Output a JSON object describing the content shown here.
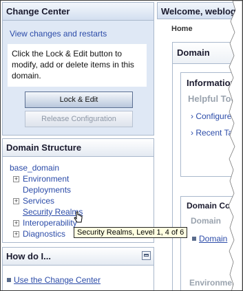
{
  "change_center": {
    "title": "Change Center",
    "view_changes_link": "View changes and restarts",
    "message": "Click the Lock & Edit button to modify, add or delete items in this domain.",
    "lock_edit_label": "Lock & Edit",
    "release_config_label": "Release Configuration"
  },
  "domain_structure": {
    "title": "Domain Structure",
    "root": "base_domain",
    "items": [
      {
        "label": "Environment",
        "expandable": true
      },
      {
        "label": "Deployments",
        "expandable": false
      },
      {
        "label": "Services",
        "expandable": true
      },
      {
        "label": "Security Realms",
        "expandable": false
      },
      {
        "label": "Interoperability",
        "expandable": true
      },
      {
        "label": "Diagnostics",
        "expandable": true
      }
    ],
    "tooltip": "Security Realms, Level 1, 4 of 6"
  },
  "how_do_i": {
    "title": "How do I...",
    "link": "Use the Change Center"
  },
  "header": {
    "welcome": "Welcome, weblogic"
  },
  "breadcrumb": {
    "home": "Home"
  },
  "domain_panel": {
    "title": "Domain",
    "information": {
      "title": "Information",
      "subtitle": "Helpful Tools",
      "links": [
        "Configure",
        "Recent Task"
      ]
    },
    "domain_config": {
      "title": "Domain Configuration",
      "subtitle": "Domain",
      "link": "Domain",
      "next_section": "Environment"
    }
  },
  "colors": {
    "link": "#2b4ba8",
    "panel_border": "#a9b8cc",
    "change_center_bg": "#dfe8f5",
    "tooltip_bg": "#ffffe1"
  },
  "icons": [
    "plus-expand-icon",
    "collapse-panel-icon",
    "bullet-icon",
    "hand-pointer-icon"
  ]
}
